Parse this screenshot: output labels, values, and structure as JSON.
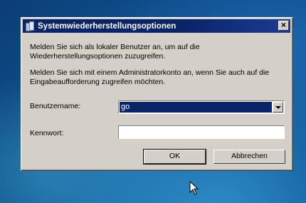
{
  "dialog": {
    "title": "Systemwiederherstellungsoptionen",
    "close_glyph": "×",
    "message1": "Melden Sie sich als lokaler Benutzer an, um auf die Wiederherstellungsoptionen zuzugreifen.",
    "message2": "Melden Sie sich mit einem Administratorkonto  an, wenn Sie auch auf die Eingabeaufforderung zugreifen möchten.",
    "username_label": "Benutzername:",
    "username_value": "go",
    "password_label": "Kennwort:",
    "password_value": "",
    "ok_label": "OK",
    "cancel_label": "Abbrechen"
  },
  "colors": {
    "titlebar": "#0a246a",
    "dialog_face": "#d4d0c8",
    "selection": "#0a246a"
  }
}
